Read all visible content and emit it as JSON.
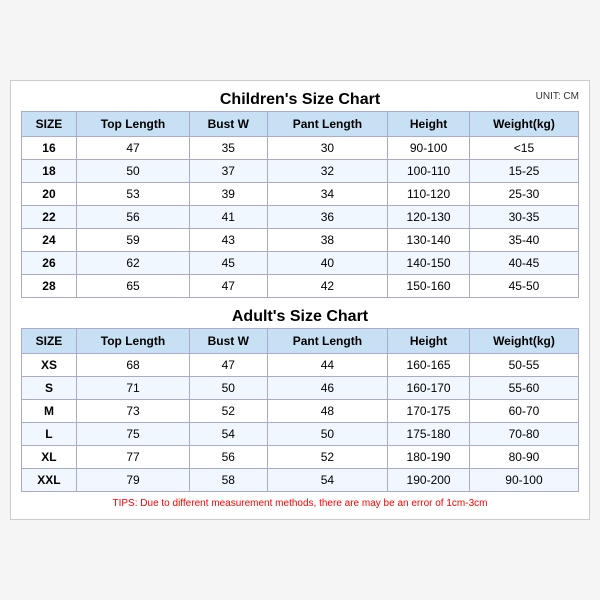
{
  "children_title": "Children's Size Chart",
  "adult_title": "Adult's Size Chart",
  "unit": "UNIT: CM",
  "children_headers": [
    "SIZE",
    "Top Length",
    "Bust W",
    "Pant Length",
    "Height",
    "Weight(kg)"
  ],
  "children_rows": [
    [
      "16",
      "47",
      "35",
      "30",
      "90-100",
      "<15"
    ],
    [
      "18",
      "50",
      "37",
      "32",
      "100-110",
      "15-25"
    ],
    [
      "20",
      "53",
      "39",
      "34",
      "110-120",
      "25-30"
    ],
    [
      "22",
      "56",
      "41",
      "36",
      "120-130",
      "30-35"
    ],
    [
      "24",
      "59",
      "43",
      "38",
      "130-140",
      "35-40"
    ],
    [
      "26",
      "62",
      "45",
      "40",
      "140-150",
      "40-45"
    ],
    [
      "28",
      "65",
      "47",
      "42",
      "150-160",
      "45-50"
    ]
  ],
  "adult_headers": [
    "SIZE",
    "Top Length",
    "Bust W",
    "Pant Length",
    "Height",
    "Weight(kg)"
  ],
  "adult_rows": [
    [
      "XS",
      "68",
      "47",
      "44",
      "160-165",
      "50-55"
    ],
    [
      "S",
      "71",
      "50",
      "46",
      "160-170",
      "55-60"
    ],
    [
      "M",
      "73",
      "52",
      "48",
      "170-175",
      "60-70"
    ],
    [
      "L",
      "75",
      "54",
      "50",
      "175-180",
      "70-80"
    ],
    [
      "XL",
      "77",
      "56",
      "52",
      "180-190",
      "80-90"
    ],
    [
      "XXL",
      "79",
      "58",
      "54",
      "190-200",
      "90-100"
    ]
  ],
  "tips": "TIPS: Due to different measurement methods, there are may be an error of 1cm-3cm"
}
